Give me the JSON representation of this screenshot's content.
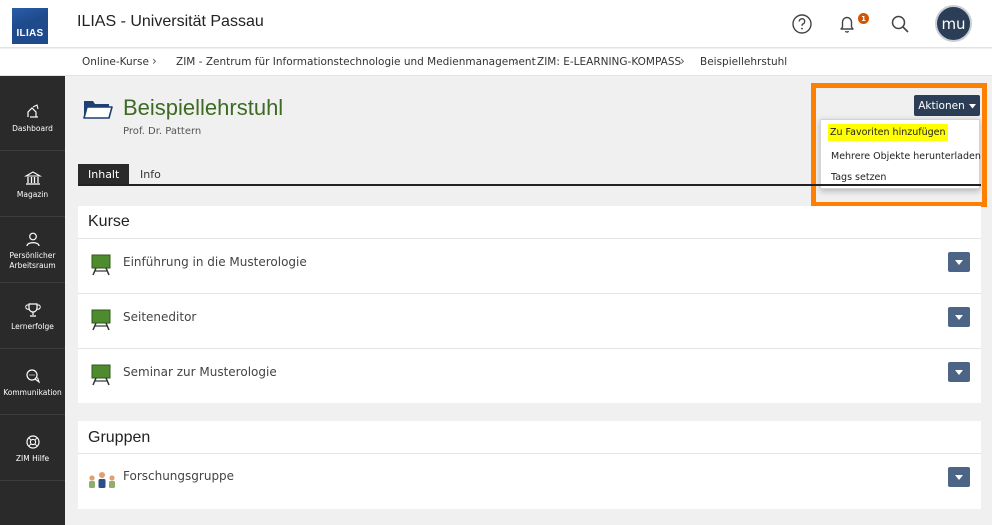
{
  "header": {
    "logo_text": "ILIAS",
    "title": "ILIAS - Universität Passau",
    "notification_count": "1",
    "avatar_initials": "mu"
  },
  "breadcrumb": [
    "Online-Kurse",
    "ZIM - Zentrum für Informationstechnologie und Medienmanagement",
    "ZIM: E-LEARNING-KOMPASS",
    "Beispiellehrstuhl"
  ],
  "sidebar": {
    "items": [
      {
        "label": "Dashboard",
        "icon": "dashboard-icon"
      },
      {
        "label": "Magazin",
        "icon": "library-icon"
      },
      {
        "label": "Persönlicher Arbeitsraum",
        "icon": "user-icon"
      },
      {
        "label": "Lernerfolge",
        "icon": "trophy-icon"
      },
      {
        "label": "Kommunikation",
        "icon": "chat-icon"
      },
      {
        "label": "ZIM Hilfe",
        "icon": "lifebuoy-icon"
      }
    ]
  },
  "page": {
    "title": "Beispiellehrstuhl",
    "subtitle": "Prof. Dr. Pattern"
  },
  "tabs": [
    {
      "label": "Inhalt",
      "active": true
    },
    {
      "label": "Info",
      "active": false
    }
  ],
  "actions": {
    "label": "Aktionen",
    "items": [
      {
        "label": "Zu Favoriten hinzufügen",
        "highlighted": true
      },
      {
        "label": "Mehrere Objekte herunterladen",
        "highlighted": false
      },
      {
        "label": "Tags setzen",
        "highlighted": false
      }
    ]
  },
  "sections": {
    "kurse": {
      "title": "Kurse",
      "items": [
        {
          "label": "Einführung in die Musterologie"
        },
        {
          "label": "Seiteneditor"
        },
        {
          "label": "Seminar zur Musterologie"
        }
      ]
    },
    "gruppen": {
      "title": "Gruppen",
      "items": [
        {
          "label": "Forschungsgruppe"
        }
      ]
    }
  },
  "colors": {
    "accent_dark": "#2c3e56",
    "title_green": "#3d6b23",
    "highlight_orange": "#ff8000",
    "highlight_yellow": "#ffff00"
  }
}
